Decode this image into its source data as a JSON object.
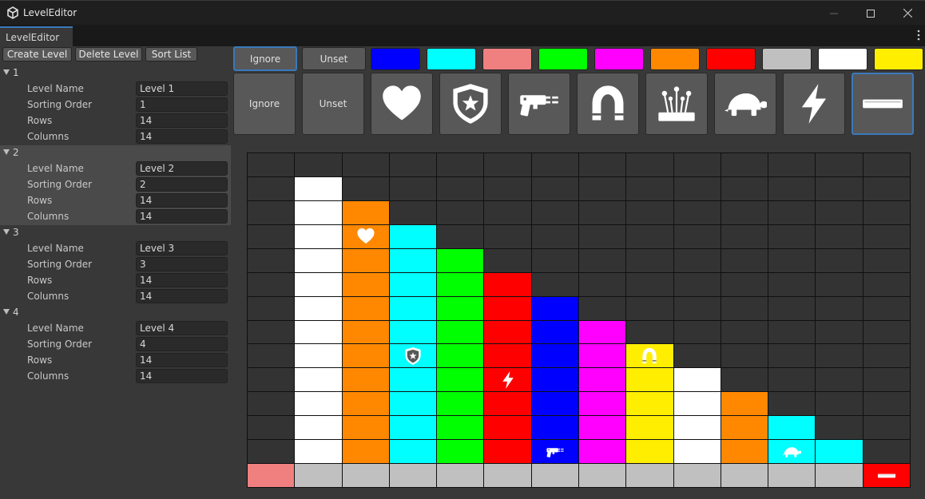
{
  "window": {
    "title": "LevelEditor"
  },
  "tab": {
    "label": "LevelEditor"
  },
  "toolbar": {
    "create": "Create Level",
    "delete": "Delete Level",
    "sort": "Sort List"
  },
  "field_labels": {
    "name": "Level Name",
    "order": "Sorting Order",
    "rows": "Rows",
    "columns": "Columns"
  },
  "levels": [
    {
      "num": "1",
      "name": "Level 1",
      "order": "1",
      "rows": "14",
      "columns": "14"
    },
    {
      "num": "2",
      "name": "Level 2",
      "order": "2",
      "rows": "14",
      "columns": "14"
    },
    {
      "num": "3",
      "name": "Level 3",
      "order": "3",
      "rows": "14",
      "columns": "14"
    },
    {
      "num": "4",
      "name": "Level 4",
      "order": "4",
      "rows": "14",
      "columns": "14"
    }
  ],
  "selected_level_index": 1,
  "palette": {
    "ignore_label": "Ignore",
    "unset_label": "Unset",
    "colors": [
      "#0000ff",
      "#00ffff",
      "#f08080",
      "#00ff00",
      "#ff00ff",
      "#ff8800",
      "#ff0000",
      "#c0c0c0",
      "#ffffff",
      "#ffee00"
    ],
    "selected": "ignore"
  },
  "powerups": {
    "ignore_label": "Ignore",
    "unset_label": "Unset",
    "items": [
      "heart-icon",
      "shield-star-icon",
      "blaster-icon",
      "magnet-icon",
      "pincushion-icon",
      "turtle-icon",
      "lightning-icon",
      "bar-icon"
    ],
    "selected": "bar-icon"
  },
  "grid": {
    "key": {
      "D": "#333333",
      "W": "#ffffff",
      "O": "#ff8800",
      "C": "#00ffff",
      "G": "#00ff00",
      "R": "#ff0000",
      "B": "#0000ff",
      "M": "#ff00ff",
      "Y": "#ffee00",
      "P": "#f08080",
      "S": "#c0c0c0"
    },
    "rows": [
      "DDDDDDDDDDDDDD",
      "DWDDDDDDDDDDDD",
      "DWODDDDDDDDDDD",
      "DWOCDDDDDDDDDD",
      "DWOCGDDDDDDDDD",
      "DWOCGRDDDDDDDD",
      "DWOCGRBDDDDDDD",
      "DWOCGRBMDDDDDD",
      "DWOCGRBMYDDDDD",
      "DWOCGRBMYWDDDD",
      "DWOCGRBMYWODDD",
      "DWOCGRBMYWOCDD",
      "DWOCGRBMYWOCCD",
      "PSSSSSSSSSSSSR"
    ],
    "icons": [
      {
        "row": 3,
        "col": 2,
        "icon": "heart-icon",
        "color": "#ffffff"
      },
      {
        "row": 8,
        "col": 3,
        "icon": "shield-star-icon",
        "color": "#ffffff"
      },
      {
        "row": 8,
        "col": 8,
        "icon": "magnet-icon",
        "color": "#ffffff"
      },
      {
        "row": 9,
        "col": 5,
        "icon": "lightning-icon",
        "color": "#ffffff"
      },
      {
        "row": 12,
        "col": 6,
        "icon": "blaster-icon",
        "color": "#ffffff"
      },
      {
        "row": 12,
        "col": 11,
        "icon": "turtle-icon",
        "color": "#ffffff"
      },
      {
        "row": 13,
        "col": 13,
        "icon": "bar-icon",
        "color": "#ffffff"
      }
    ]
  }
}
